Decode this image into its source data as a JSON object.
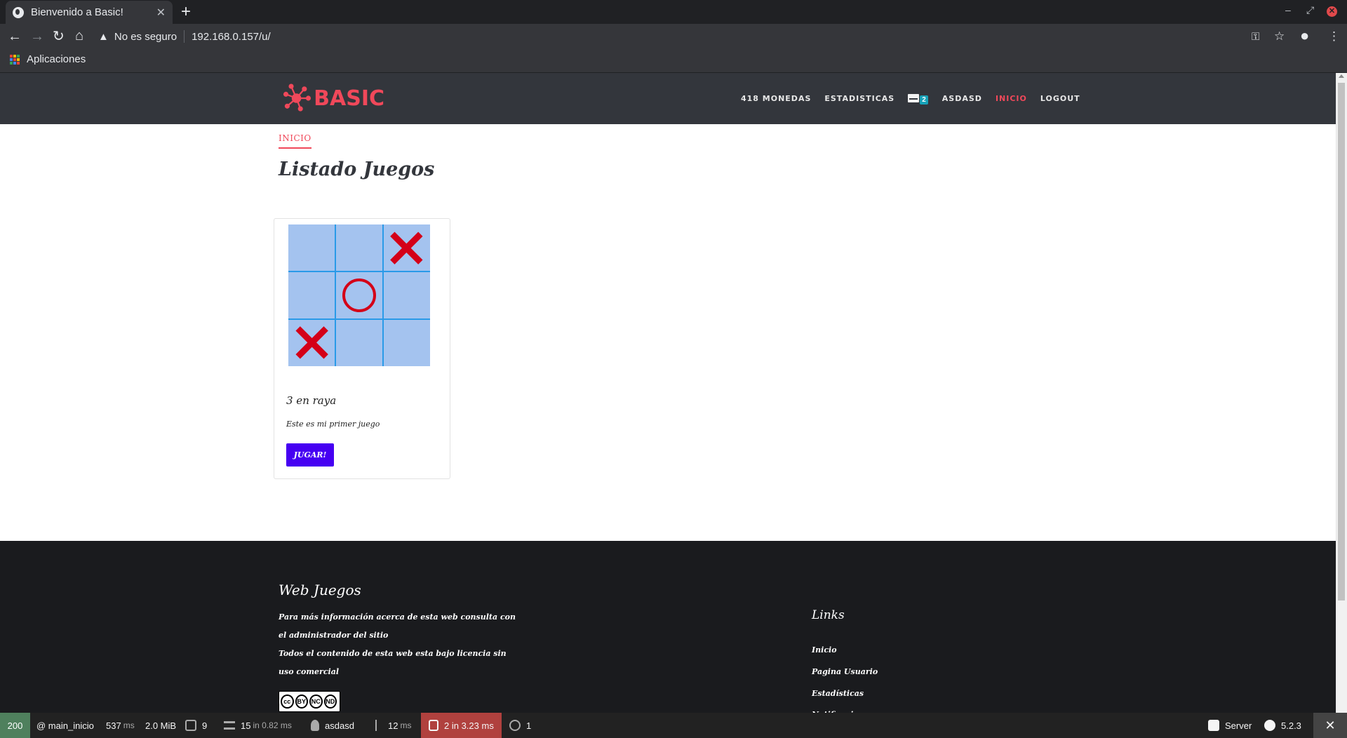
{
  "browser": {
    "tab_title": "Bienvenido a Basic!",
    "tab_close": "✕",
    "new_tab": "+",
    "security_label": "No es seguro",
    "url": "192.168.0.157/u/",
    "bookmark_apps": "Aplicaciones"
  },
  "site": {
    "logo_text": "BASIC",
    "nav": {
      "coins": "418 MONEDAS",
      "stats": "ESTADISTICAS",
      "messages_count": "2",
      "user": "ASDASD",
      "home": "INICIO",
      "logout": "LOGOUT"
    },
    "brand_color": "#f0485a",
    "header_bg": "#33363c"
  },
  "main": {
    "breadcrumb": "INICIO",
    "title": "Listado Juegos",
    "games": [
      {
        "title": "3 en raya",
        "description": "Este es mi primer juego",
        "button_label": "JUGAR!",
        "board": [
          "",
          "",
          "X",
          "",
          "O",
          "",
          "X",
          "",
          ""
        ]
      }
    ]
  },
  "footer": {
    "title": "Web Juegos",
    "text_1": "Para más información acerca de esta web consulta con el administrador del sitio",
    "text_2": "Todos el contenido de esta web esta bajo licencia sin uso comercial",
    "license_badge": [
      "cc",
      "BY",
      "NC",
      "ND"
    ],
    "links_title": "Links",
    "links": [
      "Inicio",
      "Pagina Usuario",
      "Estadísticas",
      "Notificaciones"
    ]
  },
  "symfony_toolbar": {
    "status": "200",
    "route": "@ main_inicio",
    "time_value": "537",
    "time_unit": "ms",
    "memory": "2.0 MiB",
    "requests_count": "9",
    "twig_count": "15",
    "twig_detail": "in 0.82 ms",
    "user": "asdasd",
    "events_value": "12",
    "events_unit": "ms",
    "db_queries": "2 in 3.23 ms",
    "logs_count": "1",
    "server_label": "Server",
    "version": "5.2.3",
    "close": "✕"
  }
}
